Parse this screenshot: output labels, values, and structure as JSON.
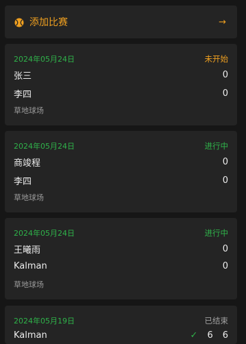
{
  "add_match": {
    "label": "添加比赛",
    "arrow": "→"
  },
  "matches": [
    {
      "date": "2024年05月24日",
      "status": "未开始",
      "p1": "张三",
      "s1": "0",
      "p2": "李四",
      "s2": "0",
      "venue": "草地球场"
    },
    {
      "date": "2024年05月24日",
      "status": "进行中",
      "p1": "商竣程",
      "s1": "0",
      "p2": "李四",
      "s2": "0",
      "venue": "草地球场"
    },
    {
      "date": "2024年05月24日",
      "status": "进行中",
      "p1": "王曦雨",
      "s1": "0",
      "p2": "Kalman",
      "s2": "0",
      "venue": "草地球场"
    },
    {
      "date": "2024年05月19日",
      "status": "已结束",
      "p1": "Kalman",
      "s1a": "6",
      "s1b": "6",
      "check": "✓"
    }
  ],
  "colors": {
    "accent": "#f0a020",
    "green": "#2fb34a",
    "card": "#242424",
    "bg": "#161616"
  }
}
